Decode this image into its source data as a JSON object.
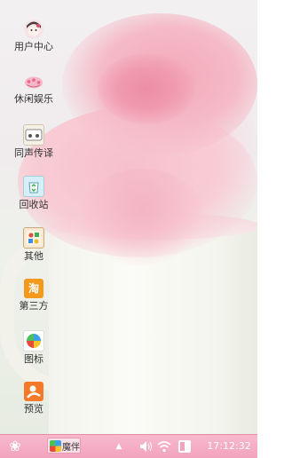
{
  "desktop": {
    "icons": [
      {
        "label": "用户中心",
        "icon": "user-avatar-icon",
        "color": "#f3e6ea"
      },
      {
        "label": "休闲娱乐",
        "icon": "entertainment-icon",
        "color": "#f4c7d3"
      },
      {
        "label": "同声传译",
        "icon": "translation-icon",
        "color": "#f2ece0"
      },
      {
        "label": "回收站",
        "icon": "recycle-bin-icon",
        "color": "#c9e6f0"
      },
      {
        "label": "其他",
        "icon": "other-apps-icon",
        "color": "#e9b98a"
      },
      {
        "label": "第三方",
        "icon": "taobao-icon",
        "color": "#f39a1d",
        "glyph": "淘"
      },
      {
        "label": "图标",
        "icon": "pinwheel-icon",
        "color": "#ffffff"
      },
      {
        "label": "预览",
        "icon": "preview-icon",
        "color": "#f47a2a"
      }
    ]
  },
  "taskbar": {
    "start_glyph": "❀",
    "task": {
      "label": "魔伴",
      "icon": "pinwheel-icon"
    },
    "tray_arrow": "▲",
    "volume_glyph": "🔊",
    "wifi_glyph": "📶",
    "time": "17:12:32"
  },
  "colors": {
    "taskbar": "#f2a3bd",
    "accent": "#f3a8b8"
  }
}
